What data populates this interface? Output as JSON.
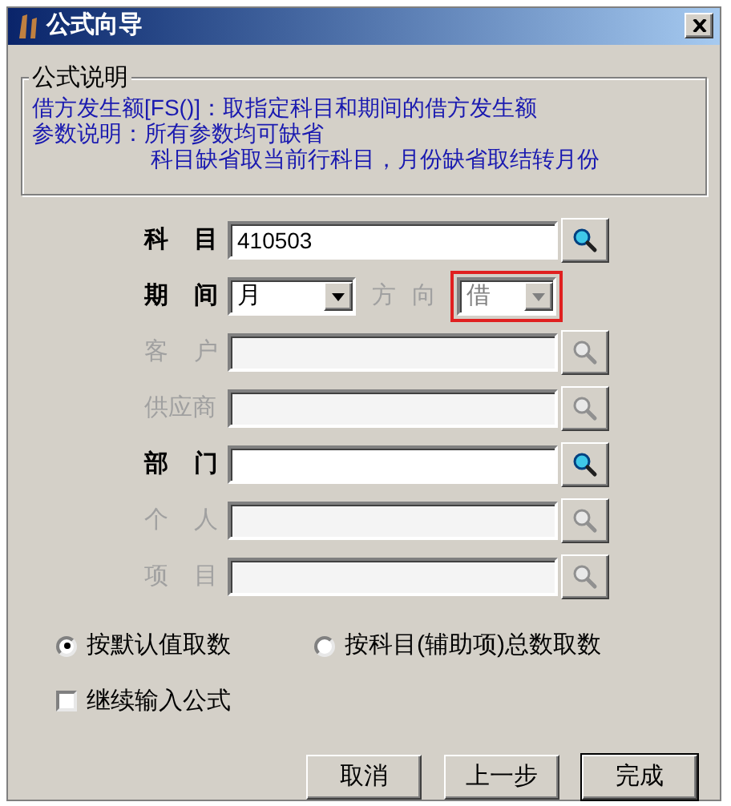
{
  "window": {
    "title": "公式向导"
  },
  "description": {
    "legend": "公式说明",
    "lines": [
      {
        "text": "借方发生额[FS()]：取指定科目和期间的借方发生额",
        "indented": false
      },
      {
        "text": "参数说明：所有参数均可缺省",
        "indented": false
      },
      {
        "text": "科目缺省取当前行科目，月份缺省取结转月份",
        "indented": true
      }
    ]
  },
  "fields": [
    {
      "kind": "lookup",
      "label": "科 目",
      "value": "410503",
      "disabled": false
    },
    {
      "kind": "selects",
      "label": "期 间",
      "value": "月",
      "disabled": false,
      "second": {
        "label": "方 向",
        "value": "借",
        "disabled": true,
        "highlighted": true
      }
    },
    {
      "kind": "lookup",
      "label": "客 户",
      "disabled": true
    },
    {
      "kind": "lookup",
      "label": "供应商",
      "disabled": true
    },
    {
      "kind": "lookup",
      "label": "部 门",
      "disabled": false
    },
    {
      "kind": "lookup",
      "label": "个 人",
      "disabled": true
    },
    {
      "kind": "lookup",
      "label": "项 目",
      "disabled": true
    }
  ],
  "radios": [
    {
      "label": "按默认值取数",
      "selected": true
    },
    {
      "label": "按科目(辅助项)总数取数",
      "selected": false
    }
  ],
  "checkbox": {
    "label": "继续输入公式",
    "checked": false
  },
  "buttons": [
    {
      "label": "取消",
      "default": false
    },
    {
      "label": "上一步",
      "default": false
    },
    {
      "label": "完成",
      "default": true
    }
  ]
}
